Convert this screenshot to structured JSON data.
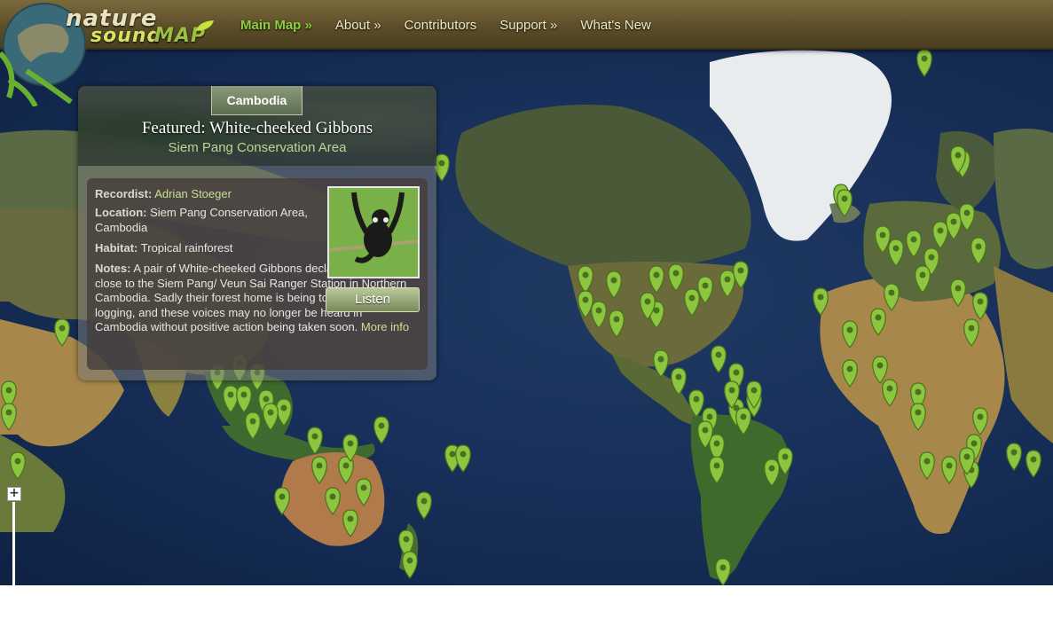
{
  "logo": {
    "word_1": "nature",
    "word_2": "sound",
    "word_3": "MAP"
  },
  "nav": [
    {
      "label": "Main Map »",
      "active": true
    },
    {
      "label": "About »",
      "active": false
    },
    {
      "label": "Contributors",
      "active": false
    },
    {
      "label": "Support »",
      "active": false
    },
    {
      "label": "What's New",
      "active": false
    }
  ],
  "featured": {
    "country": "Cambodia",
    "title": "Featured: White-cheeked Gibbons",
    "subtitle": "Siem Pang Conservation Area",
    "recordist_label": "Recordist:",
    "recordist": "Adrian Stoeger",
    "location_label": "Location:",
    "location": "Siem Pang Conservation Area, Cambodia",
    "habitat_label": "Habitat:",
    "habitat": "Tropical rainforest",
    "notes_label": "Notes:",
    "notes": "A pair of White-cheeked Gibbons declare their territory close to the Siem Pang/ Veun Sai Ranger Station in Northern Cambodia. Sadly their forest home is being torn down by illegal logging, and these voices may no longer be heard in Cambodia without positive action being taken soon.",
    "more_info": "More info",
    "listen": "Listen"
  },
  "map": {
    "zoom_in": "+",
    "marker_color": "#8cc63f",
    "marker_region_counts": {
      "scandinavia": 3,
      "europe": 9,
      "middle_east": 6,
      "africa": 9,
      "south_asia": 4,
      "southeast_asia": 9,
      "australia": 8,
      "new_zealand": 4,
      "pacific": 2,
      "north_america": 14,
      "central_america": 5,
      "south_america": 12,
      "greenland_iceland": 3,
      "west_africa_edge": 4
    }
  }
}
